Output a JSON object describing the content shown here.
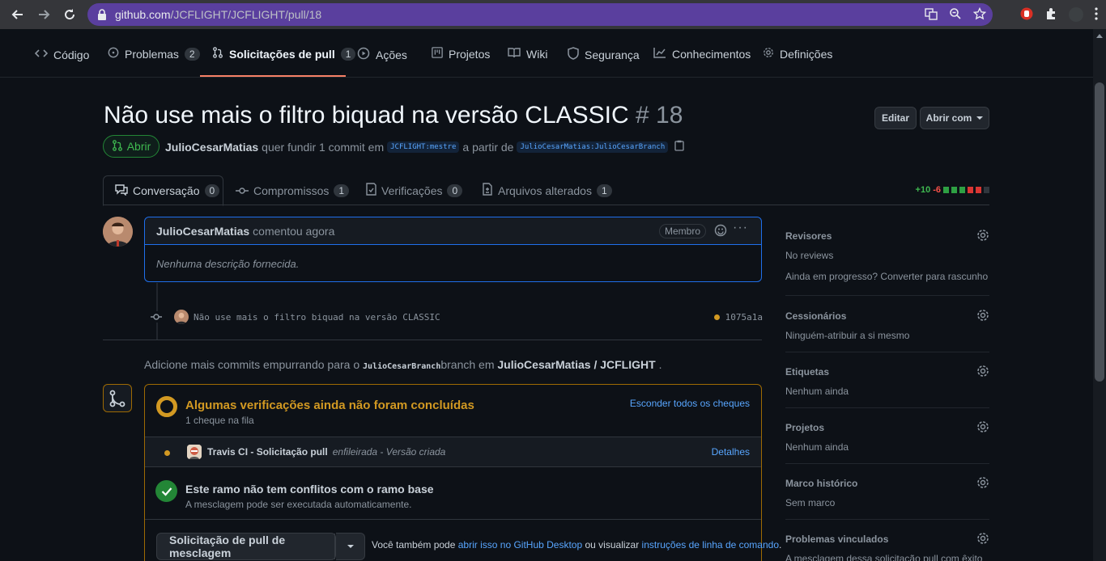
{
  "browser": {
    "url_host": "github.com",
    "url_path": "/JCFLIGHT/JCFLIGHT/pull/18"
  },
  "repo_nav": {
    "code": "Código",
    "issues": "Problemas",
    "issues_count": "2",
    "pulls": "Solicitações de pull",
    "pulls_count": "1",
    "actions": "Ações",
    "projects": "Projetos",
    "wiki": "Wiki",
    "security": "Segurança",
    "insights": "Conhecimentos",
    "settings": "Definições"
  },
  "pr": {
    "title": "Não use mais o filtro biquad na versão CLASSIC",
    "number": "# 18",
    "edit": "Editar",
    "open_with": "Abrir com",
    "state": "Abrir",
    "author": "JulioCesarMatias",
    "meta_mid": "quer fundir 1 commit em",
    "base_branch": "JCFLIGHT:mestre",
    "meta_from": "a partir de",
    "head_branch": "JulioCesarMatias:JulioCesarBranch"
  },
  "tabs": {
    "conversation": "Conversação",
    "conversation_count": "0",
    "commits": "Compromissos",
    "commits_count": "1",
    "checks": "Verificações",
    "checks_count": "0",
    "files": "Arquivos alterados",
    "files_count": "1",
    "additions": "+10",
    "deletions": "-6"
  },
  "comment": {
    "author": "JulioCesarMatias",
    "action": "comentou agora",
    "role": "Membro",
    "body": "Nenhuma descrição fornecida."
  },
  "commit": {
    "message": "Não use mais o filtro biquad na versão CLASSIC",
    "sha": "1075a1a"
  },
  "push_hint": {
    "pre": "Adicione mais commits empurrando para o",
    "branch": "JulioCesarBranch",
    "mid": "branch em",
    "repo": "JulioCesarMatias / JCFLIGHT",
    "end": "."
  },
  "checks": {
    "title": "Algumas verificações ainda não foram concluídas",
    "subtitle": "1 cheque na fila",
    "hide_link": "Esconder todos os cheques",
    "check_name": "Travis CI - Solicitação pull",
    "check_status": "enfileirada - Versão criada",
    "details": "Detalhes",
    "conflict_title": "Este ramo não tem conflitos com o ramo base",
    "conflict_sub": "A mesclagem pode ser executada automaticamente.",
    "merge_button": "Solicitação de pull de mesclagem",
    "also_pre": "Você também pode",
    "also_link1": "abrir isso no GitHub Desktop",
    "also_mid": "ou visualizar",
    "also_link2": "instruções de linha de comando",
    "also_end": "."
  },
  "sidebar": {
    "reviewers": "Revisores",
    "reviewers_val": "No reviews",
    "reviewers_hint": "Ainda em progresso? Converter para rascunho",
    "assignees": "Cessionários",
    "assignees_val": "Ninguém-atribuir a si mesmo",
    "labels": "Etiquetas",
    "labels_val": "Nenhum ainda",
    "projects": "Projetos",
    "projects_val": "Nenhum ainda",
    "milestone": "Marco histórico",
    "milestone_val": "Sem marco",
    "linked": "Problemas vinculados",
    "linked_val": "A mesclagem dessa solicitação pull com êxito pode"
  },
  "colors": {
    "accent": "#f78166",
    "success": "#238636",
    "pending": "#d29922",
    "link": "#58a6ff",
    "omnibox": "#5a3f9e"
  }
}
